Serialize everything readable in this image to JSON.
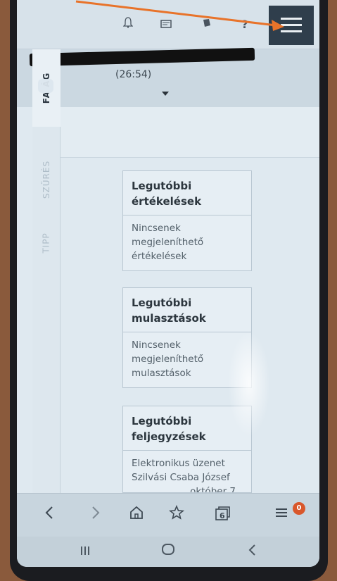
{
  "toolbar": {
    "icons": [
      "bell-icon",
      "message-icon",
      "book-icon",
      "help-icon",
      "menu-icon"
    ],
    "help_glyph": "?"
  },
  "header": {
    "time_text": "(26:54)"
  },
  "side_tabs": [
    {
      "label": "FA   ÁG",
      "active": true
    },
    {
      "label": "SZŰRÉS",
      "active": false
    },
    {
      "label": "TIPP",
      "active": false
    }
  ],
  "cards": [
    {
      "title_line1": "Legutóbbi",
      "title_line2": "értékelések",
      "body": [
        "Nincsenek",
        "megjeleníthető",
        "értékelések"
      ]
    },
    {
      "title_line1": "Legutóbbi",
      "title_line2": "mulasztások",
      "body": [
        "Nincsenek",
        "megjeleníthető",
        "mulasztások"
      ]
    },
    {
      "title_line1": "Legutóbbi",
      "title_line2": "feljegyzések",
      "body": [
        "Elektronikus üzenet",
        "Szilvási Csaba József",
        "október 7"
      ]
    }
  ],
  "browser_bar": {
    "tab_count": "6",
    "notification_badge": "0"
  },
  "colors": {
    "annotation_arrow": "#e8732a",
    "menu_button_bg": "#2f3e4c",
    "badge": "#d9572b"
  }
}
